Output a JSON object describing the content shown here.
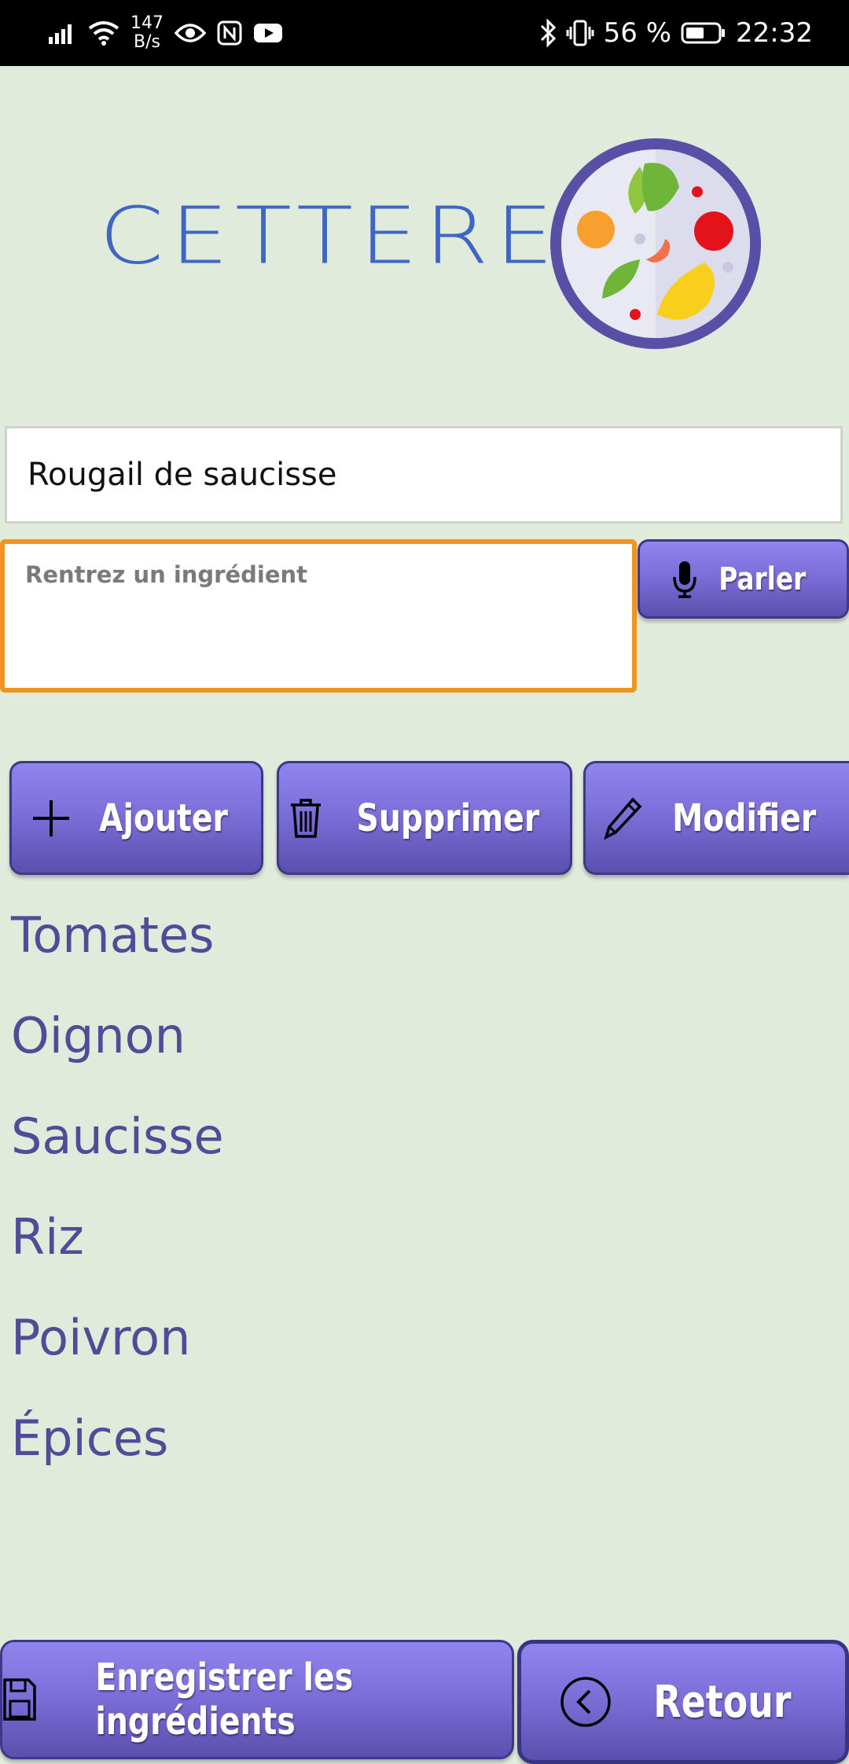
{
  "status_bar": {
    "net_speed_value": "147",
    "net_speed_unit": "B/s",
    "battery_percent": "56 %",
    "time": "22:32",
    "icons_left": [
      "signal-icon",
      "wifi-icon",
      "eye-icon",
      "nfc-icon",
      "youtube-icon"
    ],
    "icons_right": [
      "bluetooth-icon",
      "vibrate-icon",
      "battery-icon"
    ]
  },
  "header": {
    "app_name": "CETTERE",
    "logo_icon": "food-plate-icon",
    "colors": {
      "logo_text": "#3e66c2",
      "plate_rim": "#5a4fa6"
    }
  },
  "form": {
    "recipe_name_value": "Rougail de saucisse",
    "ingredient_placeholder": "Rentrez un ingrédient",
    "ingredient_value": "",
    "speak_label": "Parler"
  },
  "actions": {
    "add_label": "Ajouter",
    "delete_label": "Supprimer",
    "edit_label": "Modifier"
  },
  "ingredients": [
    "Tomates",
    "Oignon",
    "Saucisse",
    "Riz",
    "Poivron",
    "Épices"
  ],
  "footer": {
    "save_label": "Enregistrer les ingrédients",
    "back_label": "Retour"
  },
  "colors": {
    "background": "#e0ebdc",
    "button_purple": "#7d6fd9",
    "focus_border": "#f09424",
    "list_text": "#504c97"
  }
}
